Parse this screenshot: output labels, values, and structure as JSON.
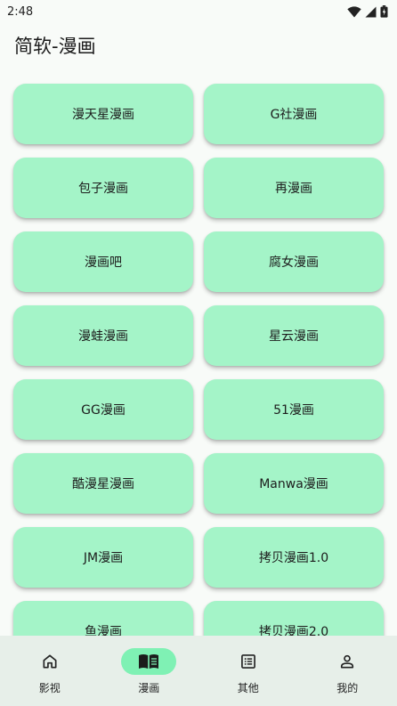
{
  "status": {
    "time": "2:48"
  },
  "app": {
    "title": "简软-漫画"
  },
  "sources": [
    "漫天星漫画",
    "G社漫画",
    "包子漫画",
    "再漫画",
    "漫画吧",
    "腐女漫画",
    "漫蛙漫画",
    "星云漫画",
    "GG漫画",
    "51漫画",
    "酷漫星漫画",
    "Manwa漫画",
    "JM漫画",
    "拷贝漫画1.0",
    "鱼漫画",
    "拷贝漫画2.0"
  ],
  "nav": [
    {
      "label": "影视",
      "icon": "home-icon",
      "active": false
    },
    {
      "label": "漫画",
      "icon": "book-icon",
      "active": true
    },
    {
      "label": "其他",
      "icon": "list-icon",
      "active": false
    },
    {
      "label": "我的",
      "icon": "person-icon",
      "active": false
    }
  ]
}
